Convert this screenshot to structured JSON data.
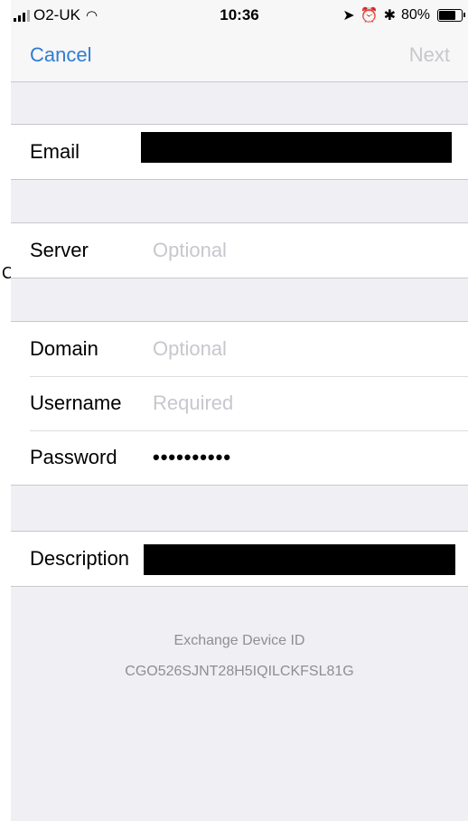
{
  "status_bar": {
    "carrier": "O2-UK",
    "time": "10:36",
    "battery": "80%",
    "battery_level": 0.8,
    "icons": [
      "signal-icon",
      "wifi-icon",
      "location-arrow-icon",
      "alarm-clock-icon",
      "bluetooth-icon",
      "battery-icon"
    ]
  },
  "nav": {
    "cancel": "Cancel",
    "next": "Next"
  },
  "form": {
    "email": {
      "label": "Email",
      "value": ""
    },
    "server": {
      "label": "Server",
      "placeholder": "Optional"
    },
    "domain": {
      "label": "Domain",
      "placeholder": "Optional"
    },
    "username": {
      "label": "Username",
      "placeholder": "Required"
    },
    "password": {
      "label": "Password",
      "value": "••••••••••"
    },
    "description": {
      "label": "Description",
      "value": ""
    }
  },
  "footer": {
    "device_id_label": "Exchange Device ID",
    "device_id": "CGO526SJNT28H5IQILCKFSL81G"
  },
  "stray_char": "C",
  "colors": {
    "accent": "#2f7dd1",
    "disabled": "#c7c7cc",
    "background": "#efeff4",
    "placeholder": "#c7c7cd",
    "footer_text": "#8e8e93"
  }
}
